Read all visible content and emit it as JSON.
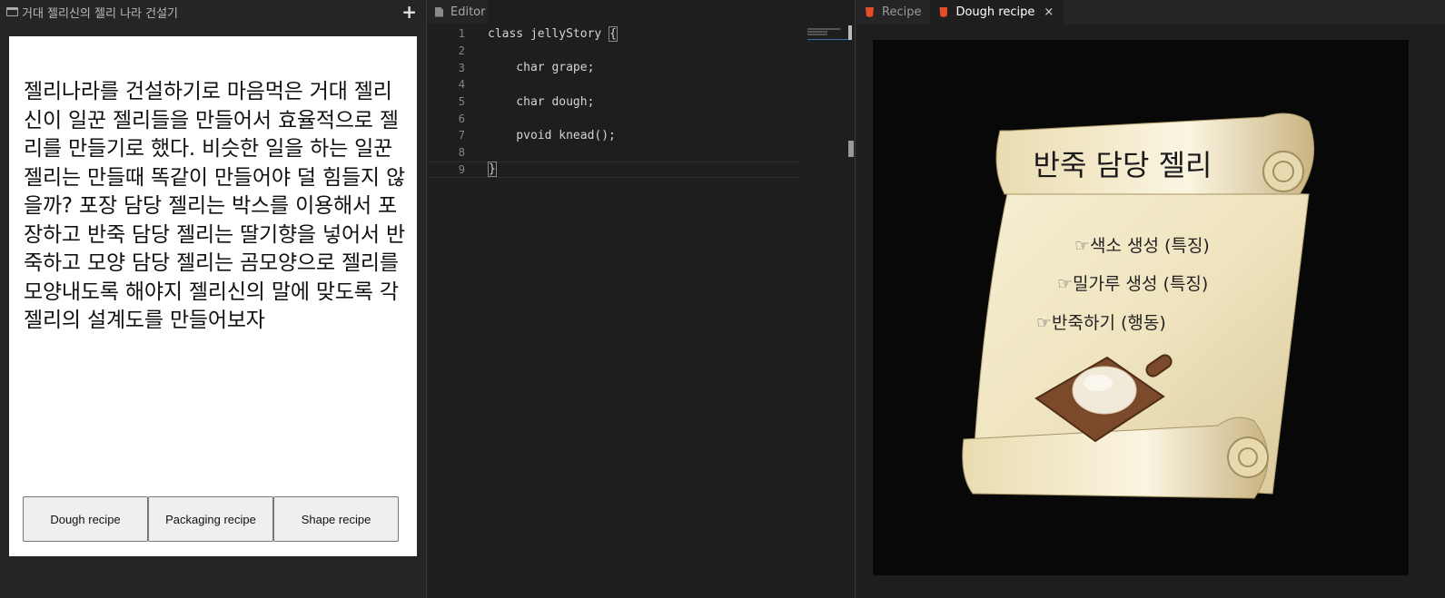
{
  "left": {
    "title": "거대 젤리신의 젤리 나라 건설기",
    "add_icon": "plus-icon",
    "story": "젤리나라를 건설하기로 마음먹은 거대 젤리신이 일꾼 젤리들을 만들어서 효율적으로 젤리를 만들기로 했다. 비슷한 일을 하는 일꾼 젤리는 만들때 똑같이 만들어야 덜 힘들지 않을까? 포장 담당 젤리는 박스를 이용해서 포장하고 반죽 담당 젤리는 딸기향을 넣어서 반죽하고 모양 담당 젤리는 곰모양으로 젤리를 모양내도록 해야지 젤리신의 말에 맞도록 각 젤리의 설계도를 만들어보자",
    "buttons": [
      "Dough recipe",
      "Packaging recipe",
      "Shape recipe"
    ]
  },
  "editor": {
    "tab_label": "Editor",
    "lines": [
      {
        "n": "1",
        "code": "class jellyStory "
      },
      {
        "n": "2",
        "code": ""
      },
      {
        "n": "3",
        "code": "    char grape;"
      },
      {
        "n": "4",
        "code": ""
      },
      {
        "n": "5",
        "code": "    char dough;"
      },
      {
        "n": "6",
        "code": ""
      },
      {
        "n": "7",
        "code": "    pvoid knead();"
      },
      {
        "n": "8",
        "code": ""
      },
      {
        "n": "9",
        "code": ""
      }
    ],
    "open_brace": "{",
    "close_brace": "}"
  },
  "preview": {
    "tabs": [
      {
        "label": "Recipe",
        "active": false
      },
      {
        "label": "Dough recipe",
        "active": true
      }
    ],
    "close_label": "×",
    "scroll_title": "반죽 담당 젤리",
    "hand": "☞",
    "features": [
      "색소 생성 (특징)",
      "밀가루 생성 (특징)",
      "반죽하기 (행동)"
    ]
  },
  "colors": {
    "background": "#1e1e1e",
    "parchment": "#efe6c4",
    "html_icon": "#e44d26"
  }
}
